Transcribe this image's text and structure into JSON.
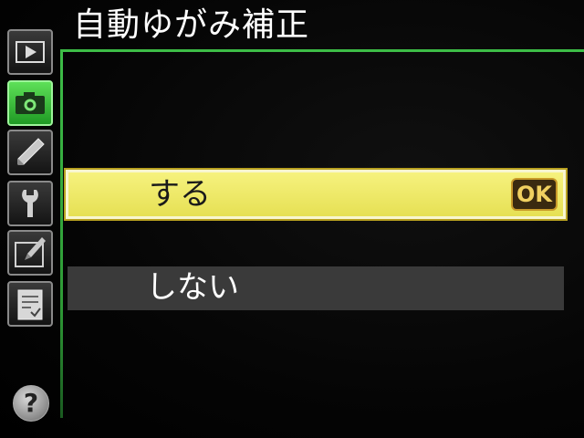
{
  "menu": {
    "title": "自動ゆがみ補正",
    "options": [
      {
        "label": "する",
        "selected": true,
        "confirm_badge": "OK"
      },
      {
        "label": "しない",
        "selected": false
      }
    ],
    "help_label": "?"
  },
  "sidebar": {
    "tabs": [
      {
        "icon": "playback-icon",
        "active": false
      },
      {
        "icon": "camera-icon",
        "active": true
      },
      {
        "icon": "pencil-icon",
        "active": false
      },
      {
        "icon": "wrench-icon",
        "active": false
      },
      {
        "icon": "retouch-icon",
        "active": false
      },
      {
        "icon": "recent-settings-icon",
        "active": false
      }
    ]
  },
  "colors": {
    "accent_green": "#3dbd47",
    "selection_yellow": "#f2ee6e",
    "unselected_gray": "#3a3a3a"
  }
}
